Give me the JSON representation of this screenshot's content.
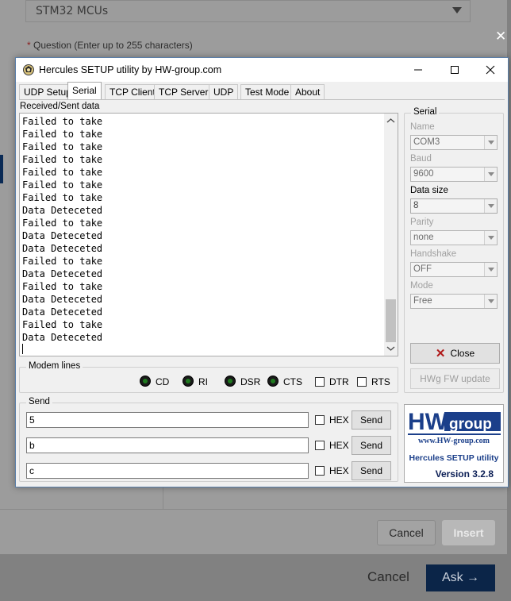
{
  "background": {
    "select_value": "STM32 MCUs",
    "question_required": "*",
    "question_label": " Question (Enter up to 255 characters)",
    "close_glyph": "✕",
    "cancel_button": "Cancel",
    "insert_button": "Insert",
    "cancel_link": "Cancel",
    "ask_button": "Ask →"
  },
  "window": {
    "title": "Hercules SETUP utility by HW-group.com",
    "tabs": [
      {
        "label": "UDP Setup"
      },
      {
        "label": "Serial",
        "active": true
      },
      {
        "label": "TCP Client"
      },
      {
        "label": "TCP Server"
      },
      {
        "label": "UDP"
      },
      {
        "label": "Test Mode"
      },
      {
        "label": "About"
      }
    ]
  },
  "received": {
    "label": "Received/Sent data",
    "lines": [
      "Failed to take",
      "Failed to take",
      "Failed to take",
      "Failed to take",
      "Failed to take",
      "Failed to take",
      "Failed to take",
      "Data Deteceted",
      "Failed to take",
      "Data Deteceted",
      "Data Deteceted",
      "Failed to take",
      "Data Deteceted",
      "Failed to take",
      "Data Deteceted",
      "Data Deteceted",
      "Failed to take",
      "Data Deteceted"
    ]
  },
  "modem": {
    "title": "Modem lines",
    "cd": "CD",
    "ri": "RI",
    "dsr": "DSR",
    "cts": "CTS",
    "dtr": "DTR",
    "rts": "RTS"
  },
  "send": {
    "title": "Send",
    "rows": [
      {
        "value": "5",
        "hex_label": "HEX",
        "button": "Send"
      },
      {
        "value": "b",
        "hex_label": "HEX",
        "button": "Send"
      },
      {
        "value": "c",
        "hex_label": "HEX",
        "button": "Send"
      }
    ]
  },
  "serial": {
    "title": "Serial",
    "name_label": "Name",
    "name_value": "COM3",
    "baud_label": "Baud",
    "baud_value": "9600",
    "datasize_label": "Data size",
    "datasize_value": "8",
    "parity_label": "Parity",
    "parity_value": "none",
    "handshake_label": "Handshake",
    "handshake_value": "OFF",
    "mode_label": "Mode",
    "mode_value": "Free",
    "close_button": "Close",
    "hwg_button": "HWg FW update"
  },
  "logo": {
    "brand_hw": "HW",
    "brand_group": "group",
    "site": "www.HW-group.com",
    "product": "Hercules SETUP utility",
    "version": "Version  3.2.8"
  },
  "colors": {
    "led_on": "#1f7a1f",
    "logo_blue": "#1b3f8a",
    "close_x": "#b01b1b"
  }
}
